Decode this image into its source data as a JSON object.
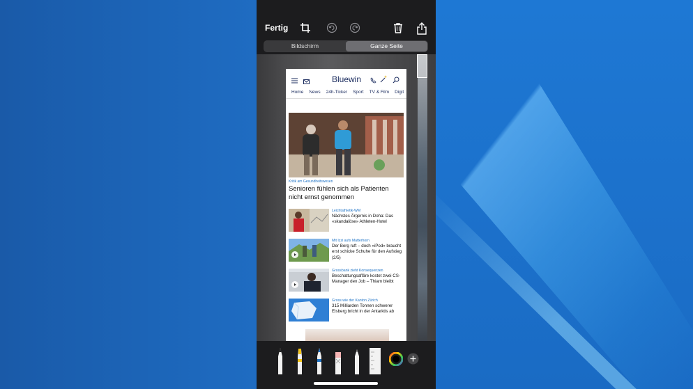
{
  "topbar": {
    "done_label": "Fertig"
  },
  "icons": {
    "crop": "crop-icon",
    "undo": "undo-icon",
    "redo": "redo-icon",
    "delete": "trash-icon",
    "share": "share-icon"
  },
  "segment": {
    "items": [
      "Bildschirm",
      "Ganze Seite"
    ],
    "selected": "Ganze Seite"
  },
  "page": {
    "brand": "Bluewin",
    "nav": [
      "Home",
      "News",
      "24h-Ticker",
      "Sport",
      "TV & Film",
      "Digit"
    ],
    "hero": {
      "category": "Kritik am Gesundheitswesen",
      "title": "Senioren fühlen sich als Patienten nicht ernst genommen"
    },
    "articles": [
      {
        "category": "Leichtathletik-WM",
        "title": "Nächstes Ärgernis in Doha: Das «skandalöse» Athleten-Hotel",
        "video": false
      },
      {
        "category": "Mit Izzi aufs Matterhorn",
        "title": "Der Berg ruft – doch «iPod» braucht erst schicke Schuhe für den Aufstieg (2/5)",
        "video": true
      },
      {
        "category": "Grossbank zieht Konsequenzen",
        "title": "Beschattungsaffäre kostet zwei CS-Manager den Job – Thiam bleibt",
        "video": true
      },
      {
        "category": "Gross wie der Kanton Zürich",
        "title": "315 Milliarden Tonnen schwerer Eisberg bricht in der Antarktis ab",
        "video": false
      }
    ]
  },
  "tools": [
    "pen-tool",
    "highlighter-tool",
    "pencil-tool",
    "eraser-tool",
    "lasso-tool",
    "ruler-tool",
    "color-picker",
    "add-tool"
  ],
  "colors": {
    "accent_blue": "#1e73c6",
    "brand_navy": "#1a2b5e",
    "chrome_dark": "#1c1c1e"
  }
}
